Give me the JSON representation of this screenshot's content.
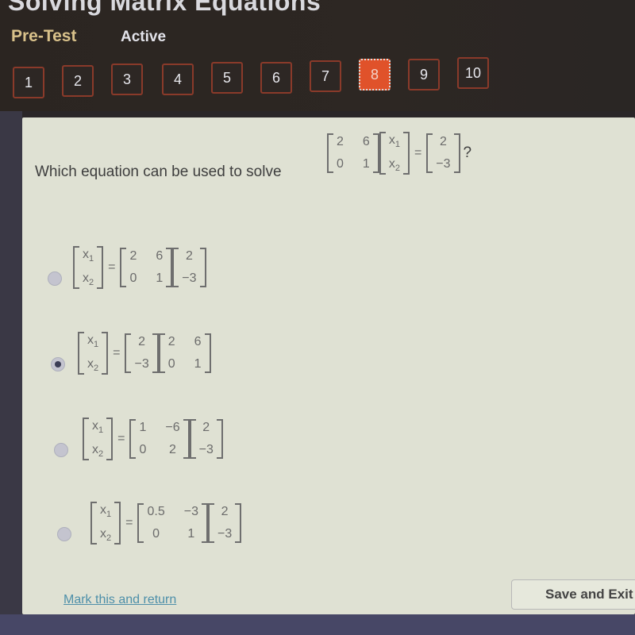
{
  "header": {
    "title": "Solving Matrix Equations",
    "subtitle": "Pre-Test",
    "status": "Active"
  },
  "question_nav": {
    "current": 8,
    "items": [
      "1",
      "2",
      "3",
      "4",
      "5",
      "6",
      "7",
      "8",
      "9",
      "10"
    ]
  },
  "question": {
    "prompt": "Which equation can be used to solve",
    "suffix": "?",
    "equals": "=",
    "matrix_a": [
      [
        "2",
        "6"
      ],
      [
        "0",
        "1"
      ]
    ],
    "vector_x": [
      "x1",
      "x2"
    ],
    "vector_b": [
      "2",
      "-3"
    ]
  },
  "options": [
    {
      "selected": false,
      "lhs": [
        "x1",
        "x2"
      ],
      "m1": [
        [
          "2",
          "6"
        ],
        [
          "0",
          "1"
        ]
      ],
      "m2": [
        [
          "2"
        ],
        [
          "-3"
        ]
      ]
    },
    {
      "selected": true,
      "lhs": [
        "x1",
        "x2"
      ],
      "m1": [
        [
          "2"
        ],
        [
          "-3"
        ]
      ],
      "m2": [
        [
          "2",
          "6"
        ],
        [
          "0",
          "1"
        ]
      ]
    },
    {
      "selected": false,
      "lhs": [
        "x1",
        "x2"
      ],
      "m1": [
        [
          "1",
          "-6"
        ],
        [
          "0",
          "2"
        ]
      ],
      "m2": [
        [
          "2"
        ],
        [
          "-3"
        ]
      ]
    },
    {
      "selected": false,
      "lhs": [
        "x1",
        "x2"
      ],
      "m1": [
        [
          "0.5",
          "-3"
        ],
        [
          "0",
          "1"
        ]
      ],
      "m2": [
        [
          "2"
        ],
        [
          "-3"
        ]
      ]
    }
  ],
  "footer": {
    "mark_link": "Mark this and return",
    "save_exit": "Save and Exit"
  }
}
